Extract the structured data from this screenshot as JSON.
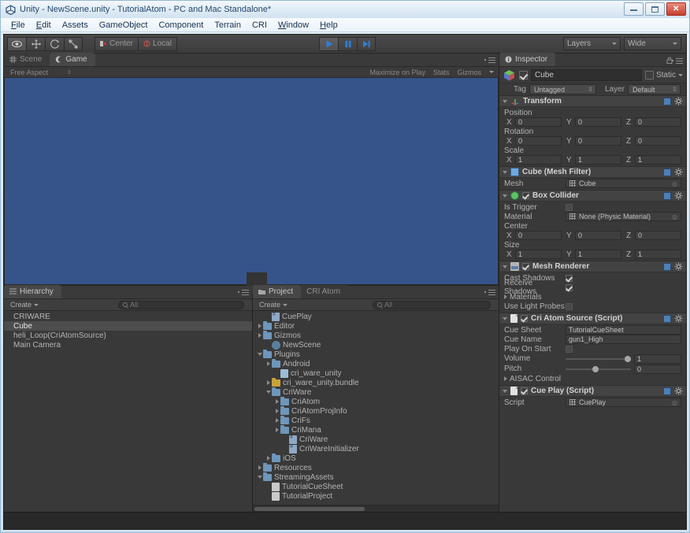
{
  "window": {
    "title": "Unity - NewScene.unity - TutorialAtom - PC and Mac Standalone*",
    "icon": "unity-logo-icon",
    "buttons": {
      "minimize": "minimize-button",
      "maximize": "maximize-button",
      "close": "close-button"
    }
  },
  "menubar": {
    "items": [
      "File",
      "Edit",
      "Assets",
      "GameObject",
      "Component",
      "Terrain",
      "CRI",
      "Window",
      "Help"
    ]
  },
  "toolbar": {
    "transform_tools": [
      "hand-tool",
      "move-tool",
      "rotate-tool",
      "scale-tool"
    ],
    "pivot": {
      "center_label": "Center",
      "local_label": "Local"
    },
    "play_controls": [
      "play-button",
      "pause-button",
      "step-button"
    ],
    "layers_label": "Layers",
    "layout_label": "Wide"
  },
  "scene_tabs": {
    "tabs": [
      {
        "label": "Scene",
        "icon": "scene-grid-icon",
        "active": false
      },
      {
        "label": "Game",
        "icon": "game-icon",
        "active": true
      }
    ]
  },
  "game_view": {
    "aspect_label": "Free Aspect",
    "maximize_label": "Maximize on Play",
    "stats_label": "Stats",
    "gizmos_label": "Gizmos",
    "background_color": "#36548a",
    "cube_color": "#333333"
  },
  "hierarchy": {
    "tab_label": "Hierarchy",
    "create_label": "Create",
    "search_placeholder": "All",
    "items": [
      {
        "label": "CRIWARE",
        "selected": false
      },
      {
        "label": "Cube",
        "selected": true
      },
      {
        "label": "heli_Loop(CriAtomSource)",
        "selected": false
      },
      {
        "label": "Main Camera",
        "selected": false
      }
    ]
  },
  "project": {
    "tabs": [
      {
        "label": "Project",
        "active": true
      },
      {
        "label": "CRI Atom",
        "active": false
      }
    ],
    "create_label": "Create",
    "search_placeholder": "All",
    "items": [
      {
        "label": "CuePlay",
        "indent": 1,
        "arrow": "none",
        "icon": "cs-script-icon"
      },
      {
        "label": "Editor",
        "indent": 0,
        "arrow": "right",
        "icon": "folder-icon"
      },
      {
        "label": "Gizmos",
        "indent": 0,
        "arrow": "right",
        "icon": "folder-icon"
      },
      {
        "label": "NewScene",
        "indent": 1,
        "arrow": "none",
        "icon": "unity-scene-icon"
      },
      {
        "label": "Plugins",
        "indent": 0,
        "arrow": "down",
        "icon": "folder-icon"
      },
      {
        "label": "Android",
        "indent": 1,
        "arrow": "right",
        "icon": "folder-icon"
      },
      {
        "label": "cri_ware_unity",
        "indent": 2,
        "arrow": "none",
        "icon": "plugin-icon"
      },
      {
        "label": "cri_ware_unity.bundle",
        "indent": 1,
        "arrow": "right",
        "icon": "bundle-icon"
      },
      {
        "label": "CriWare",
        "indent": 1,
        "arrow": "down",
        "icon": "folder-icon"
      },
      {
        "label": "CriAtom",
        "indent": 2,
        "arrow": "right",
        "icon": "folder-icon"
      },
      {
        "label": "CriAtomProjInfo",
        "indent": 2,
        "arrow": "right",
        "icon": "folder-icon"
      },
      {
        "label": "CriFs",
        "indent": 2,
        "arrow": "right",
        "icon": "folder-icon"
      },
      {
        "label": "CriMana",
        "indent": 2,
        "arrow": "right",
        "icon": "folder-icon"
      },
      {
        "label": "CriWare",
        "indent": 3,
        "arrow": "none",
        "icon": "cs-script-icon"
      },
      {
        "label": "CriWareInitializer",
        "indent": 3,
        "arrow": "none",
        "icon": "cs-script-icon"
      },
      {
        "label": "iOS",
        "indent": 1,
        "arrow": "right",
        "icon": "folder-icon"
      },
      {
        "label": "Resources",
        "indent": 0,
        "arrow": "right",
        "icon": "folder-icon"
      },
      {
        "label": "StreamingAssets",
        "indent": 0,
        "arrow": "down",
        "icon": "folder-icon"
      },
      {
        "label": "TutorialCueSheet",
        "indent": 1,
        "arrow": "none",
        "icon": "asset-file-icon"
      },
      {
        "label": "TutorialProject",
        "indent": 1,
        "arrow": "none",
        "icon": "asset-file-icon"
      }
    ]
  },
  "inspector": {
    "tab_label": "Inspector",
    "object_name": "Cube",
    "object_enabled": true,
    "static_label": "Static",
    "static_checked": false,
    "tag_label": "Tag",
    "tag_value": "Untagged",
    "layer_label": "Layer",
    "layer_value": "Default",
    "components": [
      {
        "name": "Transform",
        "icon": "transform-axis-icon",
        "has_checkbox": false,
        "vectors": [
          {
            "label": "Position",
            "x": "0",
            "y": "0",
            "z": "0"
          },
          {
            "label": "Rotation",
            "x": "0",
            "y": "0",
            "z": "0"
          },
          {
            "label": "Scale",
            "x": "1",
            "y": "1",
            "z": "1"
          }
        ]
      },
      {
        "name": "Cube (Mesh Filter)",
        "icon": "mesh-filter-icon",
        "has_checkbox": false,
        "rows": [
          {
            "label": "Mesh",
            "value": "Cube",
            "type": "object"
          }
        ]
      },
      {
        "name": "Box Collider",
        "icon": "box-collider-icon",
        "has_checkbox": true,
        "checked": true,
        "rows": [
          {
            "label": "Is Trigger",
            "type": "checkbox",
            "checked": false
          },
          {
            "label": "Material",
            "value": "None (Physic Material)",
            "type": "object"
          }
        ],
        "vectors": [
          {
            "label": "Center",
            "x": "0",
            "y": "0",
            "z": "0"
          },
          {
            "label": "Size",
            "x": "1",
            "y": "1",
            "z": "1"
          }
        ]
      },
      {
        "name": "Mesh Renderer",
        "icon": "mesh-renderer-icon",
        "has_checkbox": true,
        "checked": true,
        "rows": [
          {
            "label": "Cast Shadows",
            "type": "checkbox",
            "checked": true
          },
          {
            "label": "Receive Shadows",
            "type": "checkbox",
            "checked": true
          },
          {
            "label": "Materials",
            "type": "foldout"
          },
          {
            "label": "Use Light Probes",
            "type": "checkbox",
            "checked": false
          }
        ]
      },
      {
        "name": "Cri Atom Source (Script)",
        "icon": "script-icon",
        "has_checkbox": true,
        "checked": true,
        "rows": [
          {
            "label": "Cue Sheet",
            "value": "TutorialCueSheet",
            "type": "text"
          },
          {
            "label": "Cue Name",
            "value": "gun1_High",
            "type": "text"
          },
          {
            "label": "Play On Start",
            "type": "checkbox",
            "checked": false
          },
          {
            "label": "Volume",
            "type": "slider",
            "value": "1",
            "fill": 100
          },
          {
            "label": "Pitch",
            "type": "slider",
            "value": "0",
            "fill": 50
          },
          {
            "label": "AISAC Control",
            "type": "foldout"
          }
        ]
      },
      {
        "name": "Cue Play (Script)",
        "icon": "script-icon",
        "has_checkbox": true,
        "checked": true,
        "rows": [
          {
            "label": "Script",
            "value": "CuePlay",
            "type": "object"
          }
        ]
      }
    ]
  }
}
